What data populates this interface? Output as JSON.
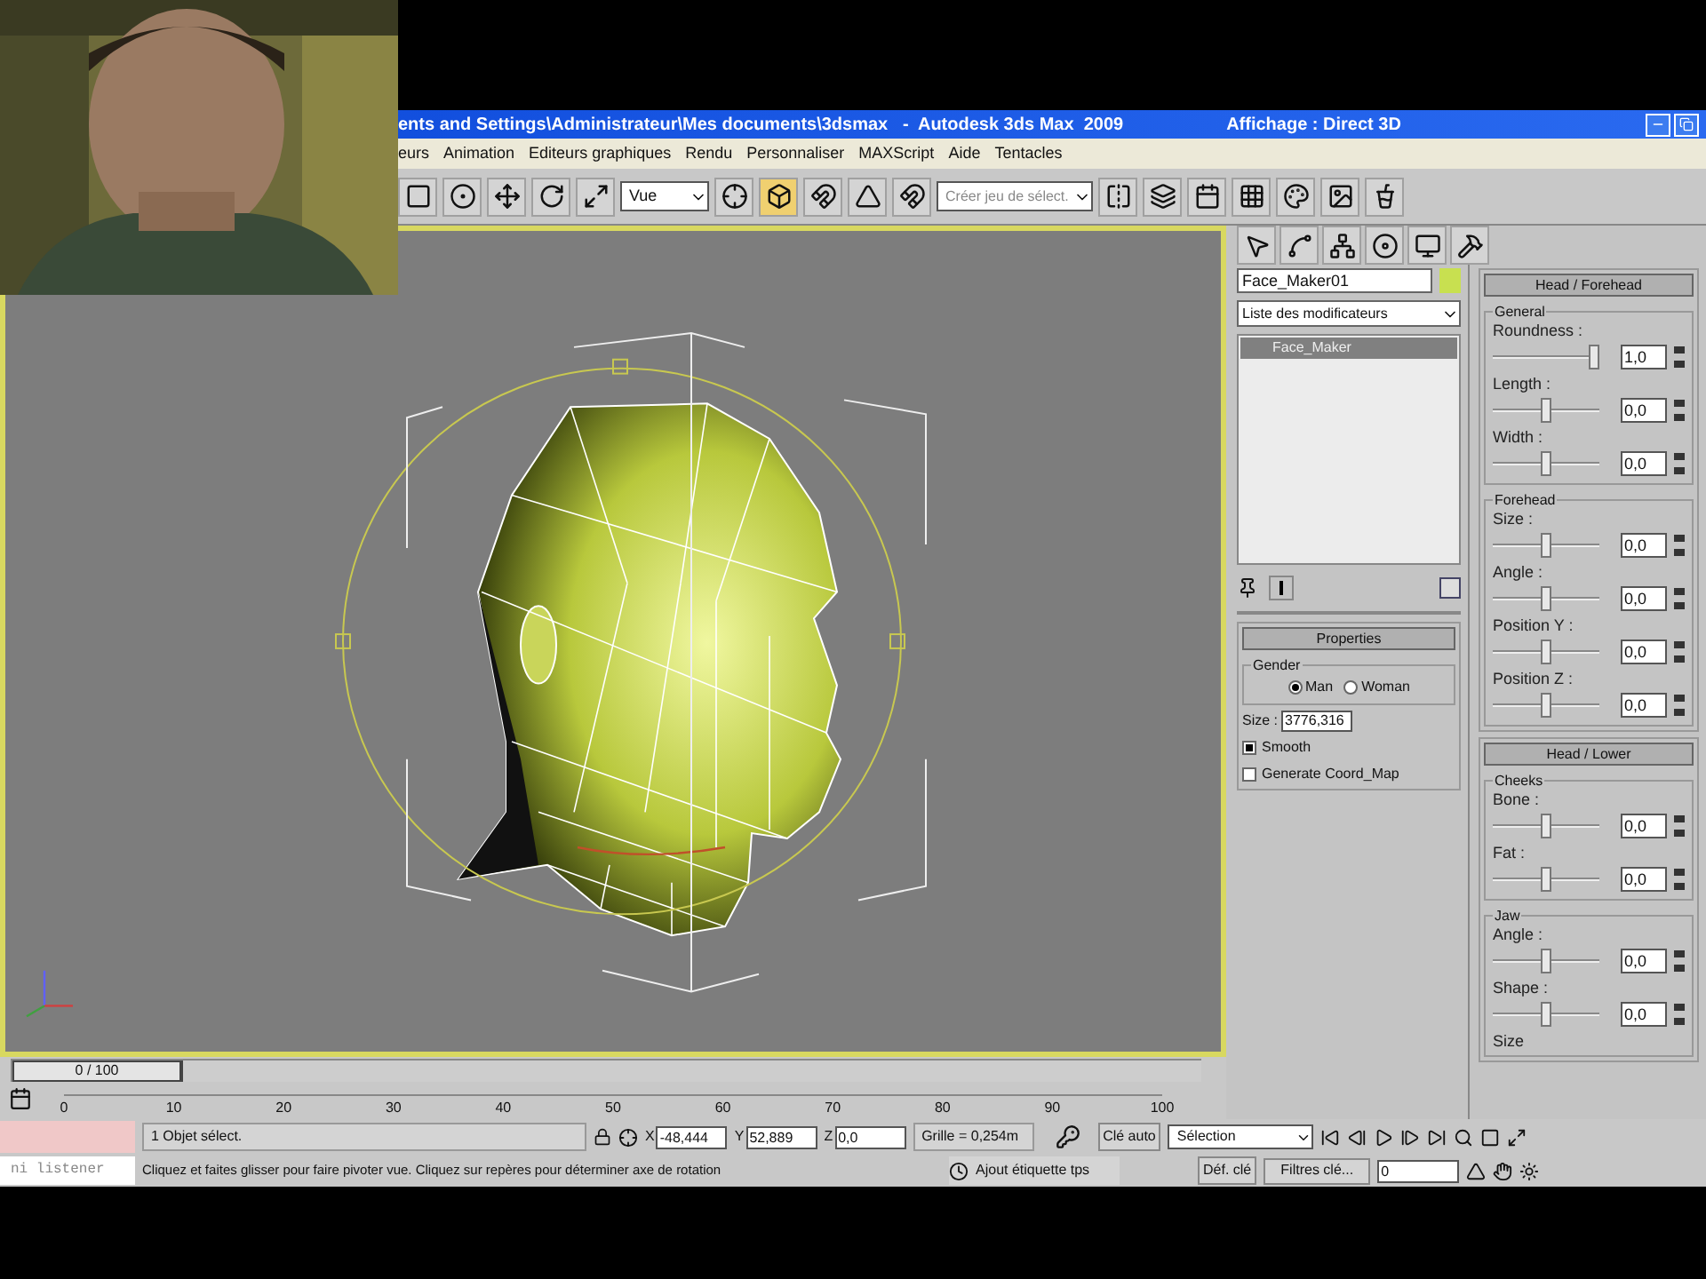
{
  "title_bar": {
    "title": "ents and Settings\\Administrateur\\Mes documents\\3dsmax   -  Autodesk 3ds Max  2009",
    "display": "Affichage : Direct 3D"
  },
  "menu": [
    "eurs",
    "Animation",
    "Editeurs graphiques",
    "Rendu",
    "Personnaliser",
    "MAXScript",
    "Aide",
    "Tentacles"
  ],
  "toolbar": {
    "view_dropdown": "Vue",
    "selection_set": {
      "placeholder": "Créer jeu de sélect."
    }
  },
  "command_panel": {
    "object_name": "Face_Maker01",
    "modifier_list": "Liste des modificateurs",
    "modifier_stack": [
      {
        "label": "Face_Maker",
        "selected": true
      }
    ],
    "properties": {
      "title": "Properties",
      "gender_label": "Gender",
      "gender": [
        {
          "label": "Man",
          "selected": true
        },
        {
          "label": "Woman",
          "selected": false
        }
      ],
      "size_label": "Size :",
      "size": "3776,316",
      "options": [
        {
          "label": "Smooth",
          "checked": true
        },
        {
          "label": "Generate Coord_Map",
          "checked": false
        }
      ]
    },
    "rollouts": [
      {
        "title": "Head / Forehead",
        "groups": [
          {
            "title": "General",
            "params": [
              {
                "label": "Roundness :",
                "value": "1,0",
                "level": 0.95
              },
              {
                "label": "Length :",
                "value": "0,0",
                "level": 0.5
              },
              {
                "label": "Width :",
                "value": "0,0",
                "level": 0.5
              }
            ]
          },
          {
            "title": "Forehead",
            "params": [
              {
                "label": "Size :",
                "value": "0,0",
                "level": 0.5
              },
              {
                "label": "Angle :",
                "value": "0,0",
                "level": 0.5
              },
              {
                "label": "Position Y :",
                "value": "0,0",
                "level": 0.5
              },
              {
                "label": "Position Z :",
                "value": "0,0",
                "level": 0.5
              }
            ]
          }
        ]
      },
      {
        "title": "Head / Lower",
        "groups": [
          {
            "title": "Cheeks",
            "params": [
              {
                "label": "Bone :",
                "value": "0,0",
                "level": 0.5
              },
              {
                "label": "Fat :",
                "value": "0,0",
                "level": 0.5
              }
            ]
          },
          {
            "title": "Jaw",
            "params": [
              {
                "label": "Angle :",
                "value": "0,0",
                "level": 0.5
              },
              {
                "label": "Shape :",
                "value": "0,0",
                "level": 0.5
              },
              {
                "label": "Size"
              }
            ]
          }
        ]
      }
    ]
  },
  "time_slider": {
    "label": "0 / 100",
    "level": 0
  },
  "track_ticks": [
    "0",
    "10",
    "20",
    "30",
    "40",
    "50",
    "60",
    "70",
    "80",
    "90",
    "100"
  ],
  "status": {
    "selection_info": "1 Objet sélect.",
    "coords": [
      {
        "axis": "X",
        "value": "-48,444"
      },
      {
        "axis": "Y",
        "value": "52,889"
      },
      {
        "axis": "Z",
        "value": "0,0"
      }
    ],
    "grid": "Grille = 0,254m",
    "prompt": "Cliquez et faites glisser pour faire pivoter vue. Cliquez sur repères pour déterminer axe de rotation",
    "add_time_tag": "Ajout étiquette tps",
    "auto_key": "Clé auto",
    "key_mode": "Sélection",
    "set_key": "Déf. clé",
    "key_filters": "Filtres clé...",
    "frame": "0",
    "listener": "ni listener"
  }
}
